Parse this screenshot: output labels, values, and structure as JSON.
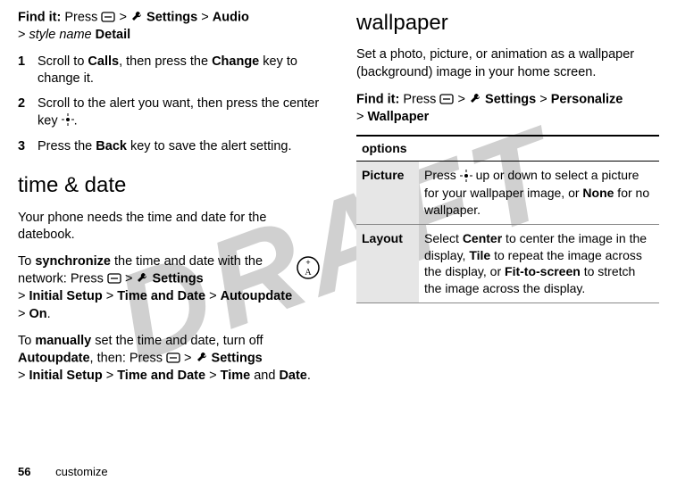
{
  "watermark": "DRAFT",
  "left": {
    "findit_label": "Find it:",
    "findit_press": "Press",
    "findit_settings": "Settings",
    "findit_audio": "Audio",
    "findit_stylename": "style name",
    "findit_detail": "Detail",
    "steps": [
      {
        "num": "1",
        "pre": "Scroll to ",
        "b1": "Calls",
        "mid": ", then press the ",
        "b2": "Change",
        "post": " key to change it."
      },
      {
        "num": "2",
        "pre": "Scroll to the alert you want, then press the center key ",
        "b1": "",
        "mid": "",
        "b2": "",
        "post": "."
      },
      {
        "num": "3",
        "pre": "Press the ",
        "b1": "Back",
        "mid": " key to save the alert setting.",
        "b2": "",
        "post": ""
      }
    ],
    "section_timedate": "time & date",
    "timedate_intro": "Your phone needs the time and date for the datebook.",
    "sync_pre": "To ",
    "sync_bold": "synchronize",
    "sync_post": " the time and date with the network: Press ",
    "sync_settings": "Settings",
    "sync_initial": "Initial Setup",
    "sync_timedate": "Time and Date",
    "sync_autoupdate": "Autoupdate",
    "sync_on": "On",
    "manual_pre": "To ",
    "manual_bold": "manually",
    "manual_post": " set the time and date, turn off ",
    "manual_autoupdate": "Autoupdate",
    "manual_then": ", then: Press ",
    "manual_settings": "Settings",
    "manual_initial": "Initial Setup",
    "manual_timedate": "Time and Date",
    "manual_time": "Time",
    "manual_and": " and ",
    "manual_date": "Date"
  },
  "right": {
    "section_wallpaper": "wallpaper",
    "wallpaper_intro": "Set a photo, picture, or animation as a wallpaper (background) image in your home screen.",
    "findit_label": "Find it:",
    "findit_press": "Press",
    "findit_settings": "Settings",
    "findit_personalize": "Personalize",
    "findit_wallpaper": "Wallpaper",
    "options_header": "options",
    "rows": [
      {
        "label": "Picture",
        "pre": "Press ",
        "post1": " up or down to select a picture for your wallpaper image, or ",
        "b1": "None",
        "post2": " for no wallpaper."
      },
      {
        "label": "Layout",
        "pre": "Select ",
        "b1": "Center",
        "mid1": " to center the image in the display, ",
        "b2": "Tile",
        "mid2": " to repeat the image across the display, or ",
        "b3": "Fit-to-screen",
        "post": " to stretch the image across the display."
      }
    ]
  },
  "footer": {
    "page": "56",
    "section": "customize"
  }
}
